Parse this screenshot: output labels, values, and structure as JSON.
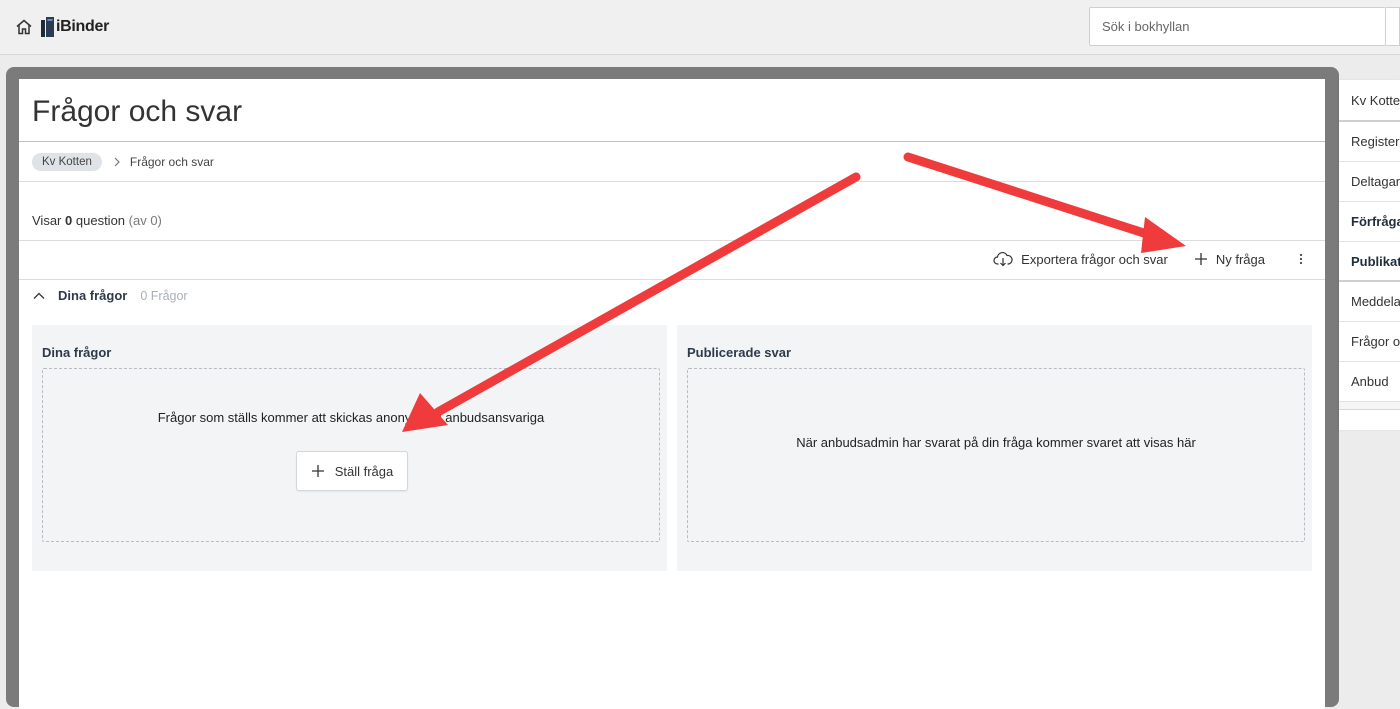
{
  "app": {
    "brand": "iBinder",
    "search_placeholder": "Sök i bokhyllan"
  },
  "page": {
    "title": "Frågor och svar",
    "breadcrumb": [
      {
        "label": "Kv Kotten"
      },
      {
        "label": "Frågor och svar"
      }
    ],
    "count": {
      "prefix": "Visar",
      "value": "0",
      "noun": "question",
      "total": "(av 0)"
    }
  },
  "toolbar": {
    "export_label": "Exportera frågor och svar",
    "new_label": "Ny fråga"
  },
  "section": {
    "title": "Dina frågor",
    "count": "0 Frågor"
  },
  "cards": {
    "left": {
      "title": "Dina frågor",
      "message": "Frågor som ställs kommer att skickas anonymt till anbudsansvariga",
      "button_label": "Ställ fråga"
    },
    "right": {
      "title": "Publicerade svar",
      "message": "När anbudsadmin har svarat på din fråga kommer svaret att visas här"
    }
  },
  "sidebar": {
    "items": [
      {
        "label": "Kv Kotten"
      },
      {
        "label": "Register"
      },
      {
        "label": "Deltagare"
      },
      {
        "label": "Förfrågan"
      },
      {
        "label": "Publikationer"
      },
      {
        "label": "Meddelanden"
      },
      {
        "label": "Frågor och svar"
      },
      {
        "label": "Anbud"
      }
    ]
  },
  "colors": {
    "accent_arrow": "#ef3b3b",
    "frame": "#7b7b7b",
    "card_bg": "#f3f4f6",
    "heading": "#2d3a4a"
  },
  "icons": [
    "home-icon",
    "ibinder-logo",
    "chevron-right-icon",
    "cloud-download-icon",
    "plus-icon",
    "kebab-menu-icon",
    "chevron-up-icon"
  ]
}
